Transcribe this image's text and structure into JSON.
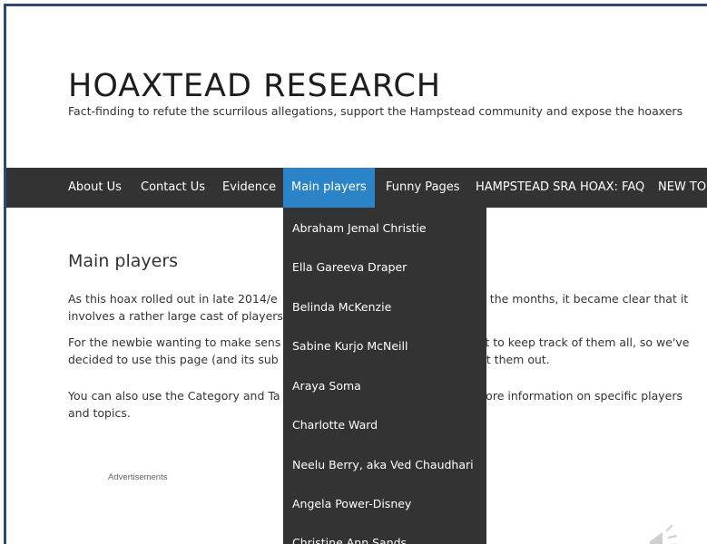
{
  "site": {
    "title": "HOAXTEAD RESEARCH",
    "tagline": "Fact-finding to refute the scurrilous allegations, support the Hampstead community and expose the hoaxers"
  },
  "nav": {
    "items": [
      {
        "label": "About Us"
      },
      {
        "label": "Contact Us"
      },
      {
        "label": "Evidence"
      },
      {
        "label": "Main players",
        "active": true
      },
      {
        "label": "Funny Pages"
      },
      {
        "label": "HAMPSTEAD SRA HOAX: FAQ"
      },
      {
        "label": "NEW TO"
      }
    ],
    "active_color": "#2c84c8",
    "bar_color": "#333333"
  },
  "dropdown": {
    "items": [
      "Abraham Jemal Christie",
      "Ella Gareeva Draper",
      "Belinda McKenzie",
      "Sabine Kurjo McNeill",
      "Araya Soma",
      "Charlotte Ward",
      "Neelu Berry, aka Ved Chaudhari",
      "Angela Power-Disney",
      "Christine Ann Sands"
    ]
  },
  "main": {
    "page_title": "Main players",
    "para1_left_line1": "As this hoax rolled out in late 2014/e",
    "para1_right_line1": "er the months, it became clear that it",
    "para1_left_line2": "involves a rather large cast of players",
    "para2_left_line1": "For the newbie wanting to make sens",
    "para2_right_line1": "ult to keep track of them all, so we've",
    "para2_left_line2": "decided to use this page (and its sub",
    "para2_right_line2": "ort them out.",
    "para3_left_line1": "You can also use the Category and Ta",
    "para3_right_line1": "more information on specific players",
    "para3_left_line2": "and topics.",
    "ads_label": "Advertisements"
  }
}
